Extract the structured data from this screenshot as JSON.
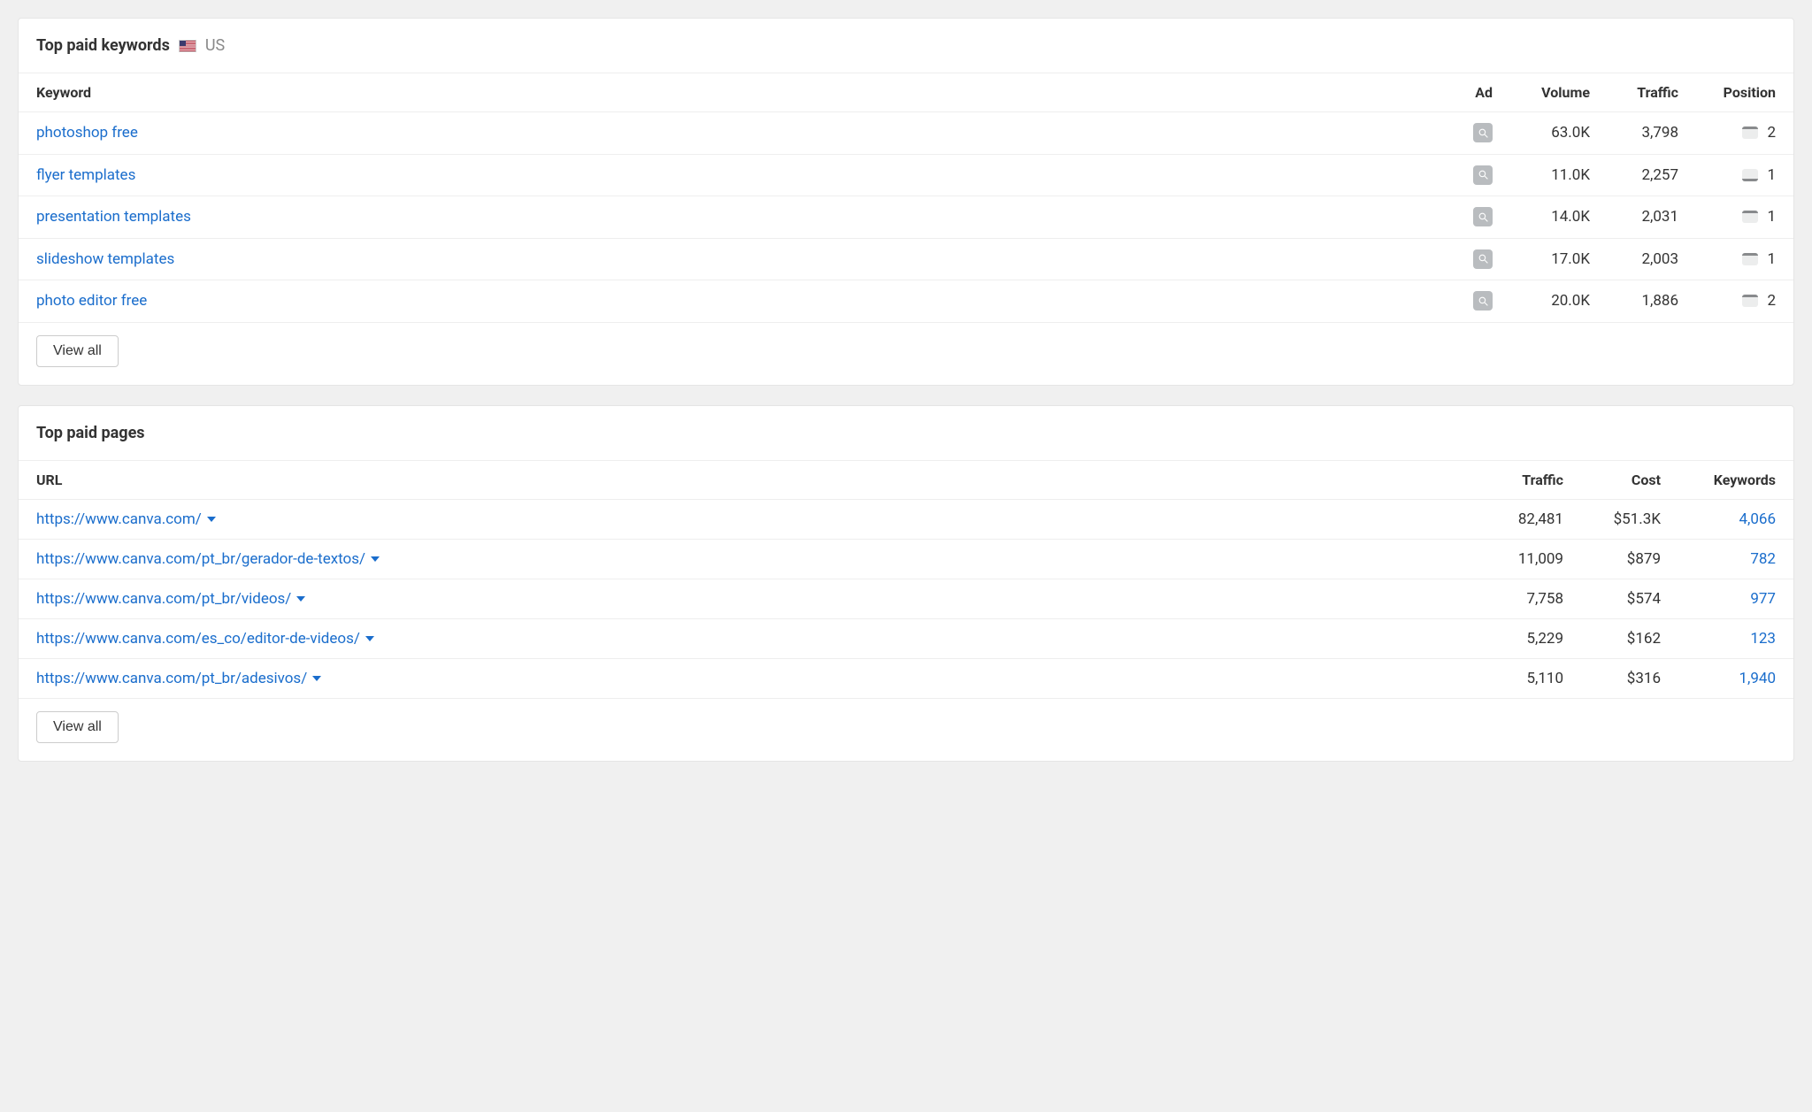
{
  "keywords_panel": {
    "title": "Top paid keywords",
    "country": "US",
    "headers": {
      "keyword": "Keyword",
      "ad": "Ad",
      "volume": "Volume",
      "traffic": "Traffic",
      "position": "Position"
    },
    "rows": [
      {
        "keyword": "photoshop free",
        "volume": "63.0K",
        "traffic": "3,798",
        "position": "2",
        "strip": "top"
      },
      {
        "keyword": "flyer templates",
        "volume": "11.0K",
        "traffic": "2,257",
        "position": "1",
        "strip": "bottom"
      },
      {
        "keyword": "presentation templates",
        "volume": "14.0K",
        "traffic": "2,031",
        "position": "1",
        "strip": "top"
      },
      {
        "keyword": "slideshow templates",
        "volume": "17.0K",
        "traffic": "2,003",
        "position": "1",
        "strip": "top"
      },
      {
        "keyword": "photo editor free",
        "volume": "20.0K",
        "traffic": "1,886",
        "position": "2",
        "strip": "top"
      }
    ],
    "view_all": "View all"
  },
  "pages_panel": {
    "title": "Top paid pages",
    "headers": {
      "url": "URL",
      "traffic": "Traffic",
      "cost": "Cost",
      "keywords": "Keywords"
    },
    "rows": [
      {
        "url": "https://www.canva.com/",
        "traffic": "82,481",
        "cost": "$51.3K",
        "keywords": "4,066"
      },
      {
        "url": "https://www.canva.com/pt_br/gerador-de-textos/",
        "traffic": "11,009",
        "cost": "$879",
        "keywords": "782"
      },
      {
        "url": "https://www.canva.com/pt_br/videos/",
        "traffic": "7,758",
        "cost": "$574",
        "keywords": "977"
      },
      {
        "url": "https://www.canva.com/es_co/editor-de-videos/",
        "traffic": "5,229",
        "cost": "$162",
        "keywords": "123"
      },
      {
        "url": "https://www.canva.com/pt_br/adesivos/",
        "traffic": "5,110",
        "cost": "$316",
        "keywords": "1,940"
      }
    ],
    "view_all": "View all"
  }
}
